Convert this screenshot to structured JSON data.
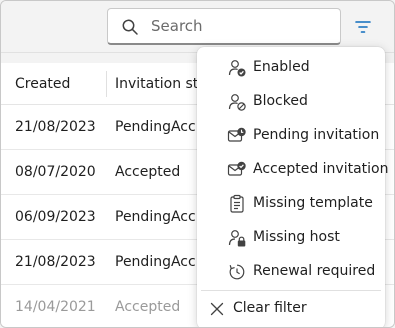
{
  "search": {
    "placeholder": "Search"
  },
  "table": {
    "columns": [
      "Created",
      "Invitation st..."
    ],
    "rows": [
      {
        "created": "21/08/2023",
        "status": "PendingAcc..."
      },
      {
        "created": "08/07/2020",
        "status": "Accepted"
      },
      {
        "created": "06/09/2023",
        "status": "PendingAcc..."
      },
      {
        "created": "21/08/2023",
        "status": "PendingAcc..."
      },
      {
        "created": "14/04/2021",
        "status": "Accepted"
      }
    ]
  },
  "filter_menu": {
    "items": [
      {
        "label": "Enabled",
        "icon": "person-check-icon"
      },
      {
        "label": "Blocked",
        "icon": "person-blocked-icon"
      },
      {
        "label": "Pending invitation",
        "icon": "mail-clock-icon"
      },
      {
        "label": "Accepted invitation",
        "icon": "mail-check-icon"
      },
      {
        "label": "Missing template",
        "icon": "clipboard-icon"
      },
      {
        "label": "Missing host",
        "icon": "person-lock-icon"
      },
      {
        "label": "Renewal required",
        "icon": "renew-icon"
      }
    ],
    "clear_label": "Clear filter"
  },
  "colors": {
    "accent": "#0f6cbd"
  }
}
